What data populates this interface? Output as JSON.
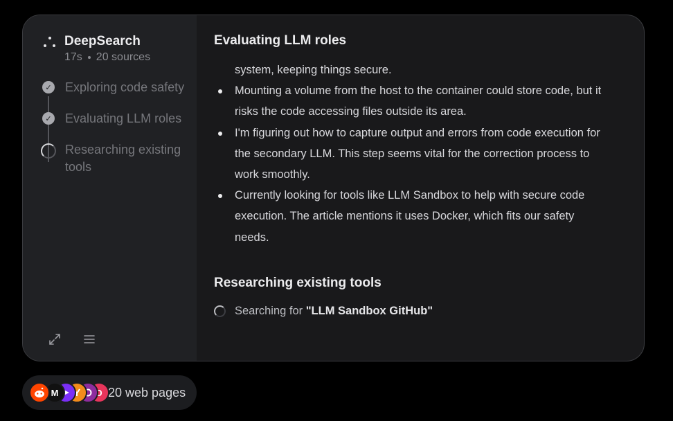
{
  "sidebar": {
    "brand": {
      "title": "DeepSearch",
      "duration": "17s",
      "sources": "20 sources"
    },
    "steps": [
      {
        "label": "Exploring code safety",
        "status": "done"
      },
      {
        "label": "Evaluating LLM roles",
        "status": "done"
      },
      {
        "label": "Researching existing tools",
        "status": "in-progress"
      }
    ],
    "tools": [
      {
        "icon": "expand-icon"
      },
      {
        "icon": "menu-icon"
      }
    ]
  },
  "main": {
    "section1_title": "Evaluating LLM roles",
    "continued_text": "system, keeping things secure.",
    "bullets": [
      "Mounting a volume from the host to the container could store code, but it risks the code accessing files outside its area.",
      "I'm figuring out how to capture output and errors from code execution for the secondary LLM. This step seems vital for the correction process to work smoothly.",
      "Currently looking for tools like LLM Sandbox to help with secure code execution. The article mentions it uses Docker, which fits our safety needs."
    ],
    "section2_title": "Researching existing tools",
    "search_prefix": "Searching for ",
    "search_query": "\"LLM Sandbox GitHub\""
  },
  "footer": {
    "label": "20 web pages",
    "favicons": [
      {
        "icon": "reddit-icon",
        "color": "#ff4500"
      },
      {
        "icon": "medium-icon",
        "color": "#111111",
        "text": "M"
      },
      {
        "icon": "arrow-site-icon",
        "color": "#7b2ff7"
      },
      {
        "icon": "orange-site-icon",
        "color": "#f28c1b"
      },
      {
        "icon": "purple-site-icon",
        "color": "#8e2c9e"
      },
      {
        "icon": "pink-site-icon",
        "color": "#e8355b",
        "text": "D"
      }
    ]
  }
}
